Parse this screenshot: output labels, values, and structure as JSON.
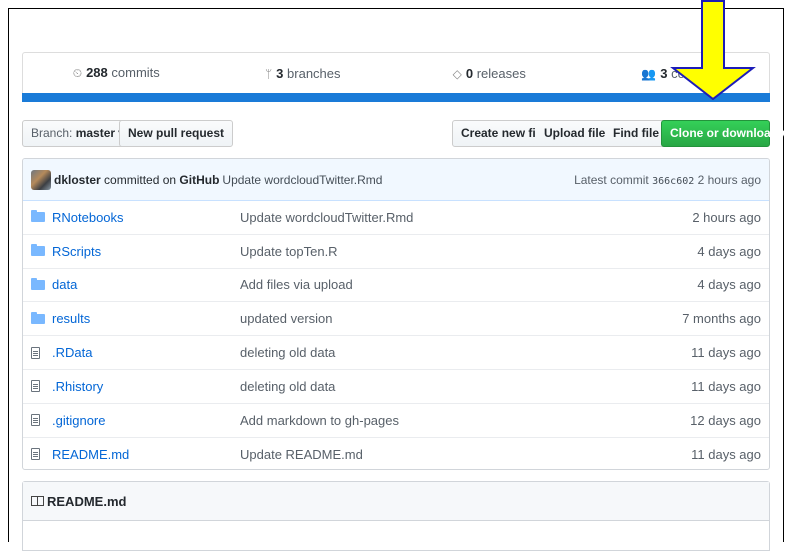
{
  "summary": {
    "commits": {
      "count": "288",
      "label": "commits",
      "icon": "history-icon"
    },
    "branches": {
      "count": "3",
      "label": "branches",
      "icon": "branch-icon"
    },
    "releases": {
      "count": "0",
      "label": "releases",
      "icon": "tag-icon"
    },
    "contributors": {
      "count": "3",
      "label": "contrib",
      "icon": "people-icon"
    }
  },
  "colors": {
    "language_bar": "#1a7bd8",
    "clone_button": "#28a745",
    "annotation_arrow": "#ffff00"
  },
  "toolbar": {
    "branch_prefix": "Branch:",
    "branch_name": "master",
    "new_pull_request": "New pull request",
    "create_new_file": "Create new file",
    "upload_files": "Upload files",
    "find_file": "Find file",
    "clone_or_download": "Clone or download"
  },
  "latest_commit": {
    "author": "dkloster",
    "committed_on": "committed on",
    "platform": "GitHub",
    "message": "Update wordcloudTwitter.Rmd",
    "latest_label": "Latest commit",
    "sha": "366c602",
    "age": "2 hours ago"
  },
  "files": [
    {
      "type": "folder",
      "name": "RNotebooks",
      "message": "Update wordcloudTwitter.Rmd",
      "age": "2 hours ago"
    },
    {
      "type": "folder",
      "name": "RScripts",
      "message": "Update topTen.R",
      "age": "4 days ago"
    },
    {
      "type": "folder",
      "name": "data",
      "message": "Add files via upload",
      "age": "4 days ago"
    },
    {
      "type": "folder",
      "name": "results",
      "message": "updated version",
      "age": "7 months ago"
    },
    {
      "type": "file",
      "name": ".RData",
      "message": "deleting old data",
      "age": "11 days ago"
    },
    {
      "type": "file",
      "name": ".Rhistory",
      "message": "deleting old data",
      "age": "11 days ago"
    },
    {
      "type": "file",
      "name": ".gitignore",
      "message": "Add markdown to gh-pages",
      "age": "12 days ago"
    },
    {
      "type": "file",
      "name": "README.md",
      "message": "Update README.md",
      "age": "11 days ago"
    }
  ],
  "readme": {
    "title": "README.md"
  }
}
